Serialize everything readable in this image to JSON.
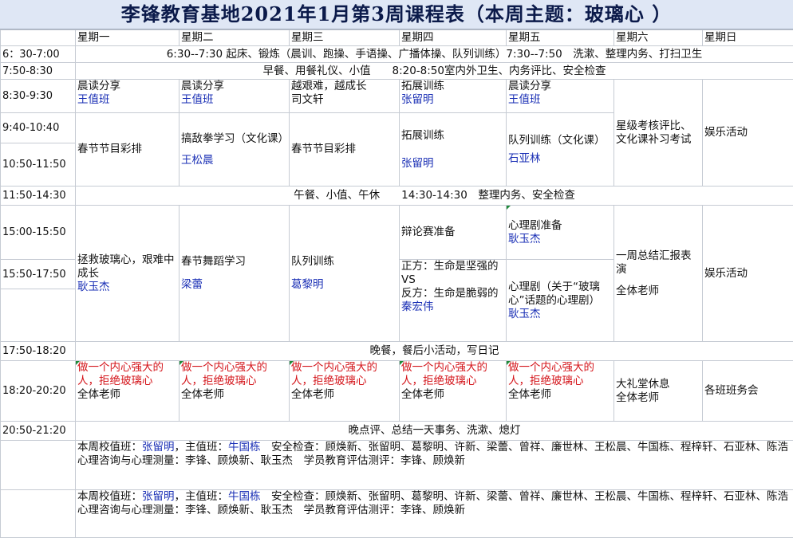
{
  "title": "李锋教育基地2021年1月第3周课程表（本周主题：玻璃心 ）",
  "days": [
    "星期一",
    "星期二",
    "星期三",
    "星期四",
    "星期五",
    "星期六",
    "星期日"
  ],
  "times": {
    "t1": "6：30-7:00",
    "t2": "7:50-8:30",
    "t3": "8:30-9:30",
    "t4": "9:40-10:40",
    "t5": "10:50-11:50",
    "t6": "11:50-14:30",
    "t7": "15:00-15:50",
    "t8": "15:50-17:50",
    "t9": "17:50-18:20",
    "t10": "18:20-20:20",
    "t11": "20:50-21:20"
  },
  "spans": {
    "r1": "6:30--7:30 起床、锻炼（晨训、跑操、手语操、广播体操、队列训练）7:30--7:50　洗漱、整理内务、打扫卫生",
    "r2": "早餐、用餐礼仪、小值　　8:20-8:50室内外卫生、内务评比、安全检查",
    "r6": "午餐、小值、午休　　14:30-14:30　整理内务、安全检查",
    "r9": "晚餐，餐后小活动，写日记",
    "r11": "晚点评、总结一天事务、洗漱、熄灯"
  },
  "morning": {
    "mon1": "晨读分享",
    "mon1_t": "王值班",
    "mon2": "春节节目彩排",
    "tue1": "晨读分享",
    "tue1_t": "王值班",
    "tue2": "搞敌拳学习（文化课）",
    "tue2_t": "王松晨",
    "wed1": "越艰难，越成长",
    "wed1_t": "司文轩",
    "wed2": "春节节目彩排",
    "thu1": "拓展训练",
    "thu1_t": "张留明",
    "thu2": "拓展训练",
    "thu2_t": "张留明",
    "fri1": "晨读分享",
    "fri1_t": "王值班",
    "fri2": "队列训练（文化课）",
    "fri2_t": "石亚林",
    "sat": "星级考核评比、文化课补习考试",
    "sun": "娱乐活动"
  },
  "afternoon": {
    "mon": "拯救玻璃心，艰难中成长",
    "mon_t": "耿玉杰",
    "tue": "春节舞蹈学习",
    "tue_t": "梁蕾",
    "wed": "队列训练",
    "wed_t": "葛黎明",
    "thu1": "辩论赛准备",
    "thu2_a": "正方：生命是坚强的",
    "thu2_b": "VS",
    "thu2_c": "反方：生命是脆弱的",
    "thu2_t": "秦宏伟",
    "fri1": "心理剧准备",
    "fri1_t": "耿玉杰",
    "fri2": "心理剧（关于“玻璃心”话题的心理剧）",
    "fri2_t": "耿玉杰",
    "sat": "一周总结汇报表演",
    "sat_t": "全体老师",
    "sun": "娱乐活动"
  },
  "evening": {
    "mon": "做一个内心强大的人，拒绝玻璃心",
    "tue": "做一个内心强大的人，拒绝玻璃心",
    "wed": "做一个内心强大的人，拒绝玻璃心",
    "thu": "做一个内心强大的人，拒绝玻璃心",
    "fri": "做一个内心强大的人，拒绝玻璃心",
    "teacher": "全体老师",
    "sat": "大礼堂休息",
    "sat_t": "全体老师",
    "sun": "各班班务会"
  },
  "notes": [
    {
      "l1a": "本周校值班：",
      "l1b": "张留明",
      "l1c": "，主值班：",
      "l1d": "牛国栋",
      "l1e": "　安全检查：顾焕新、张留明、葛黎明、许新、梁蕾、曾祥、廉世林、王松晨、牛国栋、程梓轩、石亚林、陈浩",
      "l2": "心理咨询与心理测量：李锋、顾焕新、耿玉杰　学员教育评估测评：李锋、顾焕新"
    },
    {
      "l1a": "本周校值班：",
      "l1b": "张留明",
      "l1c": "，主值班：",
      "l1d": "牛国栋",
      "l1e": "　安全检查：顾焕新、张留明、葛黎明、许新、梁蕾、曾祥、廉世林、王松晨、牛国栋、程梓轩、石亚林、陈浩",
      "l2": "心理咨询与心理测量：李锋、顾焕新、耿玉杰　学员教育评估测评：李锋、顾焕新"
    }
  ]
}
